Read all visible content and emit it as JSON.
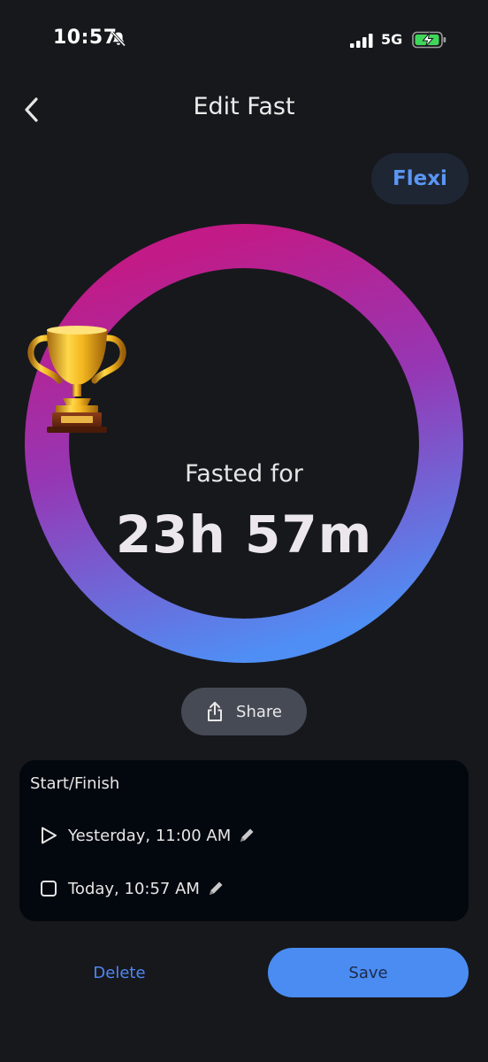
{
  "status_bar": {
    "time": "10:57",
    "network": "5G",
    "bell_icon": "bell-slash-icon",
    "signal_icon": "cellular-signal-icon",
    "battery_icon": "battery-charging-icon"
  },
  "header": {
    "title": "Edit Fast",
    "back_icon": "chevron-left-icon"
  },
  "mode_pill": {
    "label": "Flexi"
  },
  "progress_ring": {
    "progress": 1.0,
    "gradient_colors": [
      "#c21a86",
      "#9637b4",
      "#4f8ef4"
    ],
    "center_icon": "trophy-icon",
    "label": "Fasted for",
    "value": "23h 57m"
  },
  "share_button": {
    "label": "Share",
    "icon": "share-icon"
  },
  "start_finish": {
    "title": "Start/Finish",
    "start": {
      "icon": "play-icon",
      "text": "Yesterday, 11:00 AM",
      "edit_icon": "pencil-icon"
    },
    "finish": {
      "icon": "square-icon",
      "text": "Today, 10:57 AM",
      "edit_icon": "pencil-icon"
    }
  },
  "actions": {
    "delete_label": "Delete",
    "save_label": "Save"
  },
  "colors": {
    "background": "#17181c",
    "accent": "#4a8cf2",
    "card": "#03070e"
  }
}
